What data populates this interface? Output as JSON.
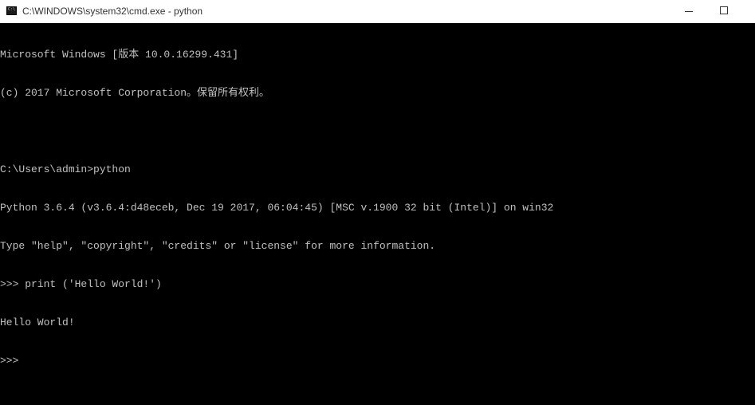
{
  "window": {
    "title": "C:\\WINDOWS\\system32\\cmd.exe - python",
    "icon_label": "C:\\",
    "icon": "cmd-icon",
    "controls": {
      "minimize_icon": "minimize-icon",
      "maximize_icon": "maximize-icon"
    }
  },
  "colors": {
    "console_background": "#000000",
    "console_text": "#c0c0c0",
    "titlebar_background": "#ffffff"
  },
  "console": {
    "lines": [
      "Microsoft Windows [版本 10.0.16299.431]",
      "(c) 2017 Microsoft Corporation。保留所有权利。",
      "",
      "C:\\Users\\admin>python",
      "Python 3.6.4 (v3.6.4:d48eceb, Dec 19 2017, 06:04:45) [MSC v.1900 32 bit (Intel)] on win32",
      "Type \"help\", \"copyright\", \"credits\" or \"license\" for more information.",
      ">>> print ('Hello World!')",
      "Hello World!",
      ">>>"
    ]
  }
}
